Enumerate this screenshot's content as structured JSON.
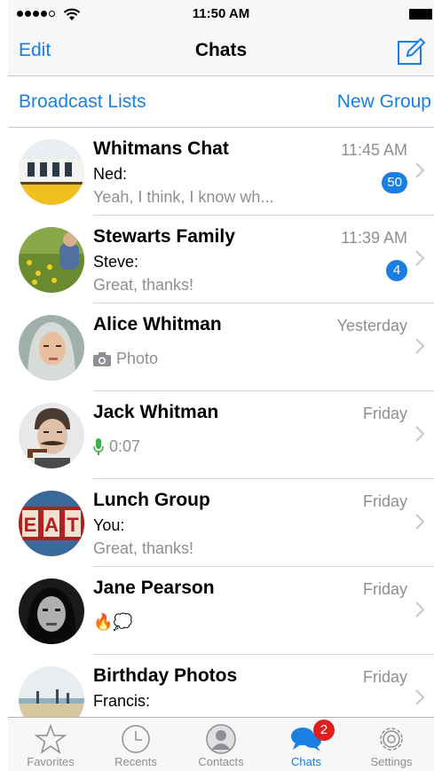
{
  "status_bar": {
    "time": "11:50 AM"
  },
  "nav": {
    "edit_label": "Edit",
    "title": "Chats"
  },
  "sub_bar": {
    "broadcast_label": "Broadcast Lists",
    "new_group_label": "New Group"
  },
  "chats": [
    {
      "name": "Whitmans Chat",
      "time": "11:45 AM",
      "sender": "Ned:",
      "preview": "Yeah, I think, I know wh...",
      "badge": "50"
    },
    {
      "name": "Stewarts Family",
      "time": "11:39 AM",
      "sender": "Steve:",
      "preview": "Great, thanks!",
      "badge": "4"
    },
    {
      "name": "Alice Whitman",
      "time": "Yesterday",
      "media_label": "Photo",
      "media_icon": "camera-icon"
    },
    {
      "name": "Jack Whitman",
      "time": "Friday",
      "media_label": "0:07",
      "media_icon": "microphone-icon"
    },
    {
      "name": "Lunch Group",
      "time": "Friday",
      "sender": "You:",
      "preview": "Great, thanks!"
    },
    {
      "name": "Jane Pearson",
      "time": "Friday",
      "media_label": "🔥💭"
    },
    {
      "name": "Birthday Photos",
      "time": "Friday",
      "sender": "Francis:"
    }
  ],
  "tabs": [
    {
      "label": "Favorites",
      "icon": "star-icon"
    },
    {
      "label": "Recents",
      "icon": "clock-icon"
    },
    {
      "label": "Contacts",
      "icon": "person-icon"
    },
    {
      "label": "Chats",
      "icon": "chat-bubbles-icon",
      "badge": "2",
      "active": true
    },
    {
      "label": "Settings",
      "icon": "gear-icon"
    }
  ],
  "colors": {
    "accent": "#1a7fe0",
    "badge_red": "#e02020",
    "secondary_text": "#8e8e93"
  }
}
